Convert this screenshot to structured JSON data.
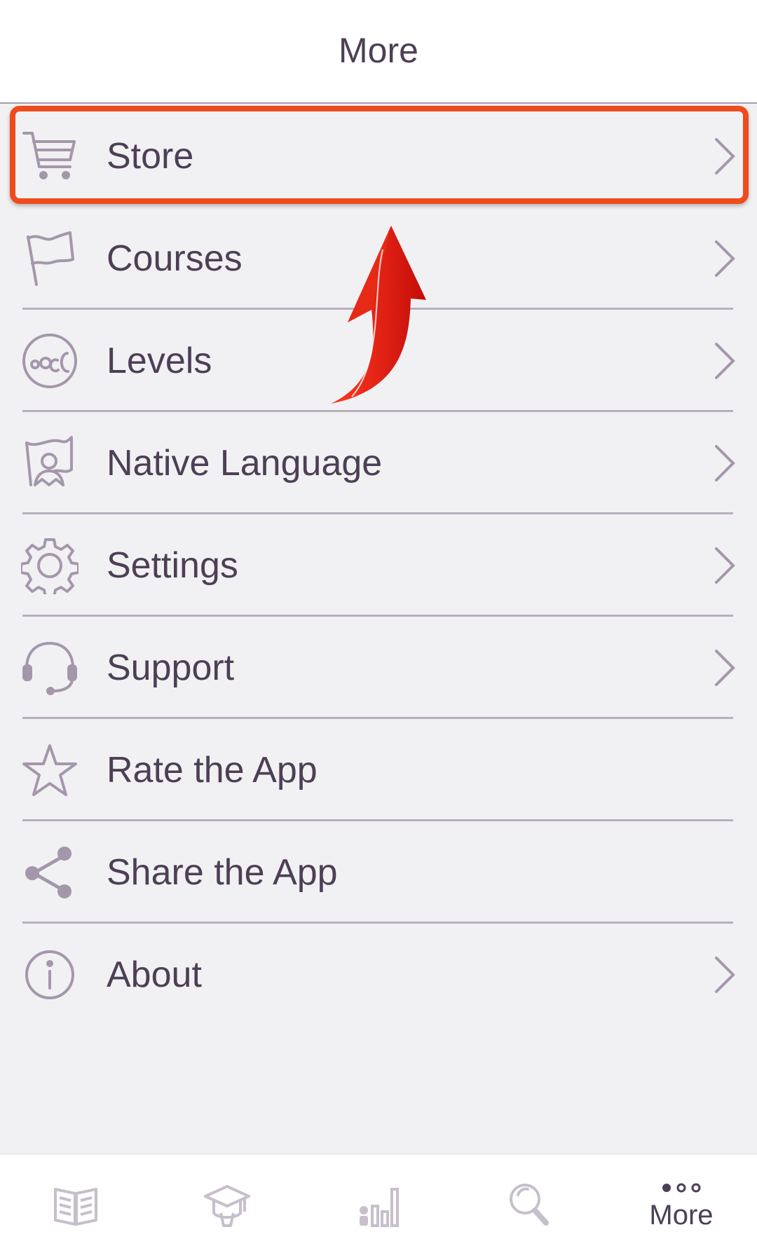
{
  "header": {
    "title": "More"
  },
  "menu": {
    "items": [
      {
        "label": "Store",
        "icon": "cart-icon",
        "has_chevron": true
      },
      {
        "label": "Courses",
        "icon": "flag-icon",
        "has_chevron": true
      },
      {
        "label": "Levels",
        "icon": "levels-icon",
        "has_chevron": true
      },
      {
        "label": "Native Language",
        "icon": "native-language-icon",
        "has_chevron": true
      },
      {
        "label": "Settings",
        "icon": "gear-icon",
        "has_chevron": true
      },
      {
        "label": "Support",
        "icon": "headset-icon",
        "has_chevron": true
      },
      {
        "label": "Rate the App",
        "icon": "star-icon",
        "has_chevron": false
      },
      {
        "label": "Share the App",
        "icon": "share-icon",
        "has_chevron": false
      },
      {
        "label": "About",
        "icon": "info-icon",
        "has_chevron": true
      }
    ]
  },
  "tabbar": {
    "tabs": [
      {
        "icon": "book-icon",
        "label": ""
      },
      {
        "icon": "graduation-cap-icon",
        "label": ""
      },
      {
        "icon": "stats-icon",
        "label": ""
      },
      {
        "icon": "search-icon",
        "label": ""
      },
      {
        "icon": "more-dots-icon",
        "label": "More",
        "active": true
      }
    ]
  },
  "colors": {
    "text": "#4d3f55",
    "icon": "#a597ab",
    "background": "#f1f1f3",
    "highlight": "#f04b1d",
    "arrow": "#e3150f"
  }
}
